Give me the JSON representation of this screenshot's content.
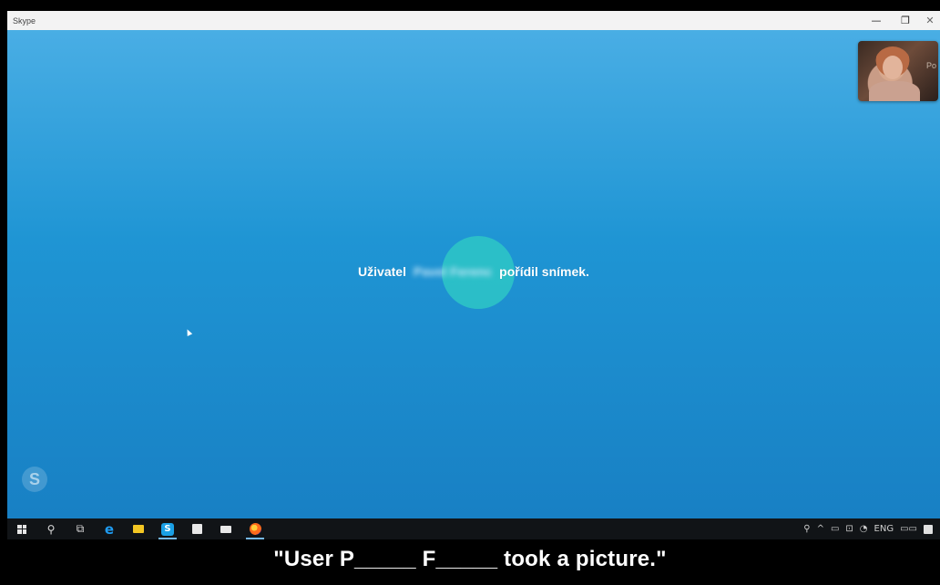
{
  "window": {
    "title": "Skype",
    "minimize_glyph": "—",
    "restore_glyph": "❐",
    "close_glyph": "✕"
  },
  "self_view": {
    "bg_text": "Po"
  },
  "notice": {
    "prefix": "Uživatel",
    "name": "Pavel Ferenc",
    "suffix": "pořídil snímek."
  },
  "skype_badge": "S",
  "taskbar": {
    "items": [
      "start-icon",
      "search-icon",
      "task-view-icon",
      "edge-icon",
      "file-explorer-icon",
      "skype-icon",
      "store-icon",
      "mail-icon",
      "firefox-icon"
    ],
    "tray": {
      "people": "⚲",
      "chevron": "^",
      "battery": "▭",
      "network": "⊡",
      "volume": "◔",
      "lang": "ENG",
      "keyboard": "▭▭"
    }
  },
  "caption": "\"User P_____ F_____ took a picture.\""
}
